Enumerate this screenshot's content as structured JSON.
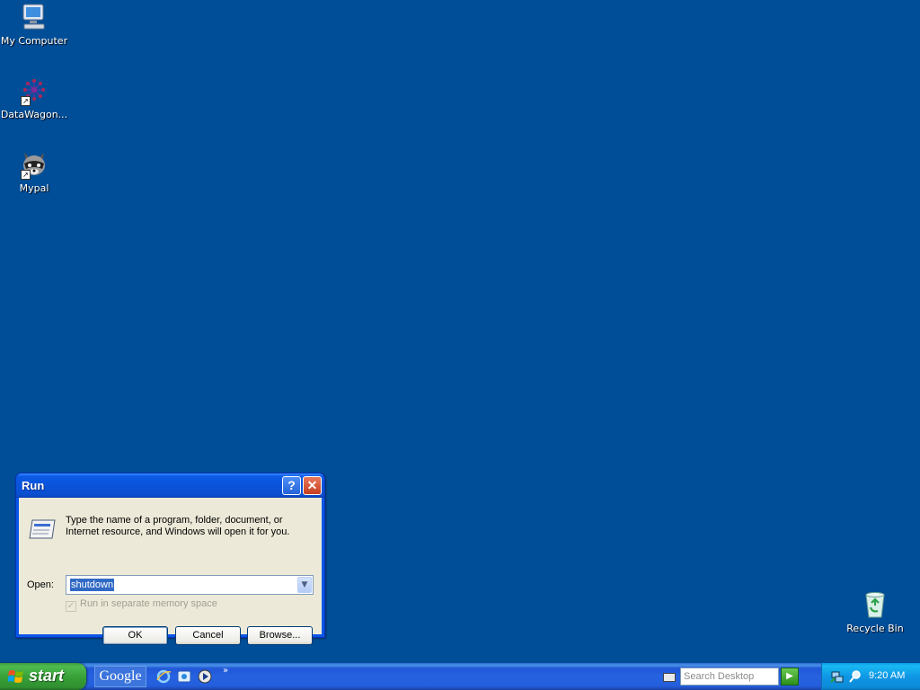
{
  "desktop": {
    "icons": [
      {
        "label": "My Computer",
        "icon": "computer-icon"
      },
      {
        "label": "DataWagon...",
        "icon": "datawagon-icon"
      },
      {
        "label": "Mypal",
        "icon": "mypal-raccoon-icon"
      },
      {
        "label": "Recycle Bin",
        "icon": "recycle-bin-icon"
      }
    ]
  },
  "run_dialog": {
    "title": "Run",
    "help_glyph": "?",
    "close_glyph": "✕",
    "description": "Type the name of a program, folder, document, or Internet resource, and Windows will open it for you.",
    "open_label": "Open:",
    "open_value": "shutdown",
    "checkbox_label": "Run in separate memory space",
    "checkbox_checked": true,
    "checkbox_enabled": false,
    "ok_label": "OK",
    "cancel_label": "Cancel",
    "browse_label": "Browse..."
  },
  "taskbar": {
    "start_label": "start",
    "google_label": "Google",
    "quicklaunch_more": "»",
    "search_placeholder": "Search Desktop",
    "clock": "9:20 AM"
  },
  "colors": {
    "desktop_bg": "#004e98",
    "taskbar_blue": "#245edc",
    "start_green": "#38a238",
    "dialog_face": "#ece9d8"
  }
}
